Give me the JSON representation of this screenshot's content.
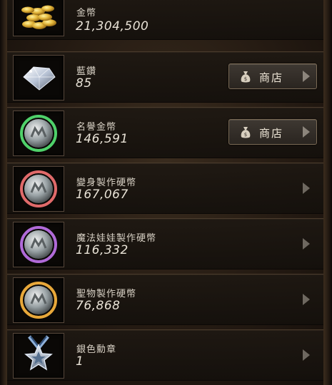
{
  "currencies": [
    {
      "name": "金幣",
      "value": "21,304,500",
      "icon": "gold-coins-icon",
      "color": "#e2b53a",
      "has_shop": false
    },
    {
      "name": "藍鑽",
      "value": "85",
      "icon": "blue-diamond-icon",
      "color": "#cfd7e6",
      "has_shop": true,
      "shop_label": "商店"
    },
    {
      "name": "名譽金幣",
      "value": "146,591",
      "icon": "honor-coin-icon",
      "color": "#4fd16a",
      "has_shop": true,
      "shop_label": "商店"
    },
    {
      "name": "變身製作硬幣",
      "value": "167,067",
      "icon": "transform-coin-icon",
      "color": "#e06a6a",
      "has_shop": false
    },
    {
      "name": "魔法娃娃製作硬幣",
      "value": "116,332",
      "icon": "doll-coin-icon",
      "color": "#b06ad8",
      "has_shop": false
    },
    {
      "name": "聖物製作硬幣",
      "value": "76,868",
      "icon": "relic-coin-icon",
      "color": "#e8a83a",
      "has_shop": false
    },
    {
      "name": "銀色勳章",
      "value": "1",
      "icon": "silver-medal-icon",
      "color": "#8fb0d8",
      "has_shop": false
    }
  ]
}
